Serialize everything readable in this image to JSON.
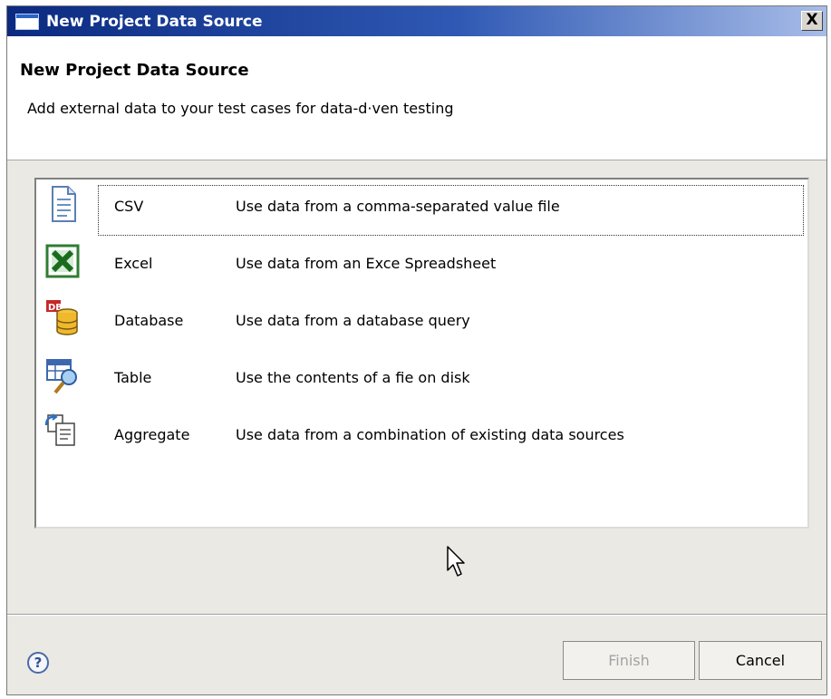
{
  "window": {
    "title": "New Project Data Source",
    "close_label": "X"
  },
  "header": {
    "title": "New Project Data Source",
    "description": "Add external data to your test cases for data-d·ven testing"
  },
  "sources": [
    {
      "name": "CSV",
      "description": "Use data from a comma-separated value file",
      "icon": "text-file-icon"
    },
    {
      "name": "Excel",
      "description": "Use data from an Exce Spreadsheet",
      "icon": "excel-icon"
    },
    {
      "name": "Database",
      "description": "Use data from a database query",
      "icon": "database-icon"
    },
    {
      "name": "Table",
      "description": "Use the contents of a fie on disk",
      "icon": "table-search-icon"
    },
    {
      "name": "Aggregate",
      "description": "Use data from a combination of existing data sources",
      "icon": "aggregate-icon"
    }
  ],
  "selected_source": "CSV",
  "footer": {
    "help_label": "?",
    "finish_label": "Finish",
    "cancel_label": "Cancel",
    "finish_enabled": false
  }
}
